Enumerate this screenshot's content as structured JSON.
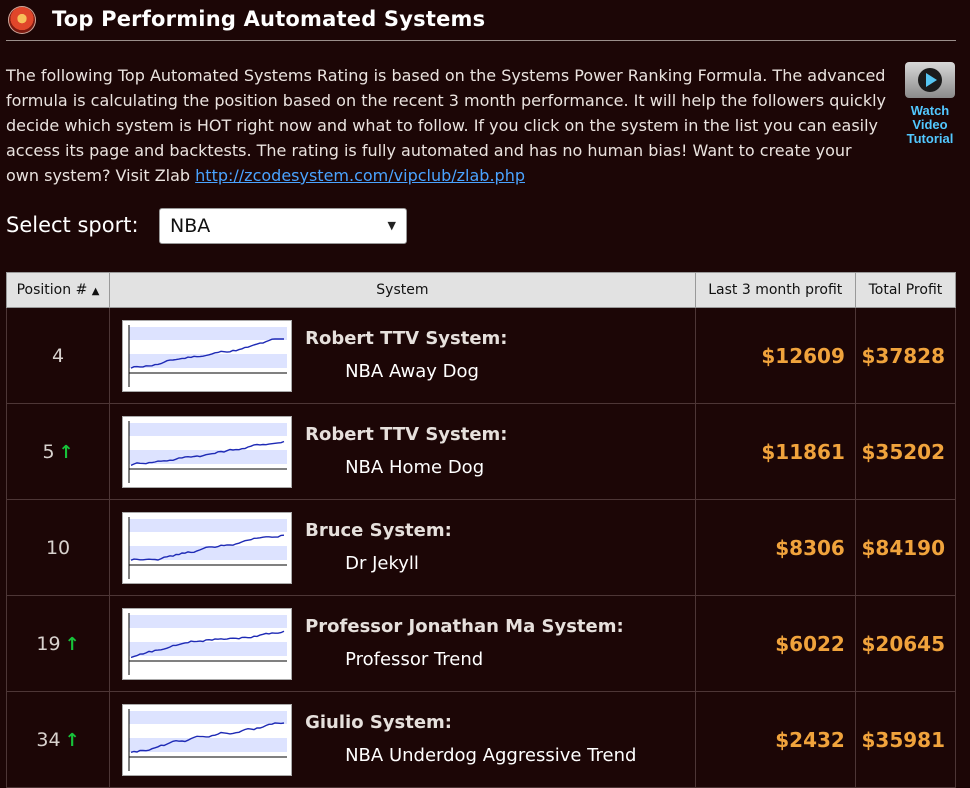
{
  "page": {
    "title": "Top Performing Automated Systems",
    "intro_text": "The following Top Automated Systems Rating is based on the Systems Power Ranking Formula. The advanced formula is calculating the position based on the recent 3 month performance. It will help the followers quickly decide which system is HOT right now and what to follow. If you click on the system in the list you can easily access its page and backtests. The rating is fully automated and has no human bias! Want to create your own system? Visit Zlab ",
    "intro_link": "http://zcodesystem.com/vipclub/zlab.php",
    "video": {
      "line1": "Watch",
      "line2": "Video",
      "line3": "Tutorial"
    },
    "select_label": "Select sport:",
    "select_value": "NBA"
  },
  "table": {
    "headers": {
      "position": "Position #",
      "system": "System",
      "last3": "Last 3 month profit",
      "total": "Total Profit"
    },
    "rows": [
      {
        "position": "4",
        "trend_up": false,
        "owner": "Robert TTV System:",
        "name": "NBA Away Dog",
        "last3": "$12609",
        "total": "$37828"
      },
      {
        "position": "5",
        "trend_up": true,
        "owner": "Robert TTV System:",
        "name": "NBA Home Dog",
        "last3": "$11861",
        "total": "$35202"
      },
      {
        "position": "10",
        "trend_up": false,
        "owner": "Bruce System:",
        "name": "Dr Jekyll",
        "last3": "$8306",
        "total": "$84190"
      },
      {
        "position": "19",
        "trend_up": true,
        "owner": "Professor Jonathan Ma System:",
        "name": "Professor Trend",
        "last3": "$6022",
        "total": "$20645"
      },
      {
        "position": "34",
        "trend_up": true,
        "owner": "Giulio System:",
        "name": "NBA Underdog Aggressive Trend",
        "last3": "$2432",
        "total": "$35981"
      }
    ]
  },
  "colors": {
    "background": "#1c0606",
    "profit": "#f0a33c",
    "link": "#4aa3ff",
    "trend_up": "#17c23a"
  },
  "icons": {
    "logo": "flame-logo-icon",
    "sort": "sort-asc-icon",
    "trend": "arrow-up-icon",
    "play": "play-icon"
  }
}
